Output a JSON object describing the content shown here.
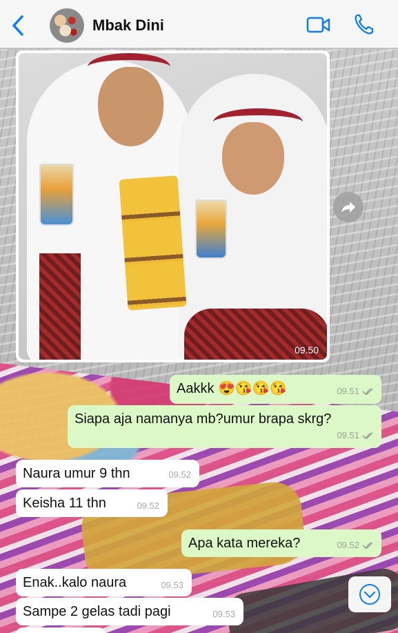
{
  "header": {
    "contact_name": "Mbak Dini",
    "icons": {
      "back": "chevron-left-icon",
      "video": "video-camera-icon",
      "call": "phone-icon"
    },
    "accent_color": "#0a7cff"
  },
  "messages": [
    {
      "type": "image",
      "direction": "incoming",
      "time": "09.50"
    },
    {
      "type": "text",
      "direction": "outgoing",
      "text": "Aakkk 😍😘😘😘",
      "time": "09.51",
      "status": "read"
    },
    {
      "type": "text",
      "direction": "outgoing",
      "text": "Siapa aja namanya mb?umur brapa skrg?",
      "time": "09.51",
      "status": "read"
    },
    {
      "type": "text",
      "direction": "incoming",
      "text": "Naura umur 9 thn",
      "time": "09.52"
    },
    {
      "type": "text",
      "direction": "incoming",
      "text": "Keisha 11 thn",
      "time": "09.52"
    },
    {
      "type": "text",
      "direction": "outgoing",
      "text": "Apa kata mereka?",
      "time": "09.52",
      "status": "read"
    },
    {
      "type": "text",
      "direction": "incoming",
      "text": "Enak..kalo naura",
      "time": "09.53"
    },
    {
      "type": "text",
      "direction": "incoming",
      "text": "Sampe 2 gelas tadi pagi",
      "time": "09.53"
    }
  ],
  "colors": {
    "outgoing_bubble": "#dcf8c6",
    "incoming_bubble": "#ffffff"
  }
}
